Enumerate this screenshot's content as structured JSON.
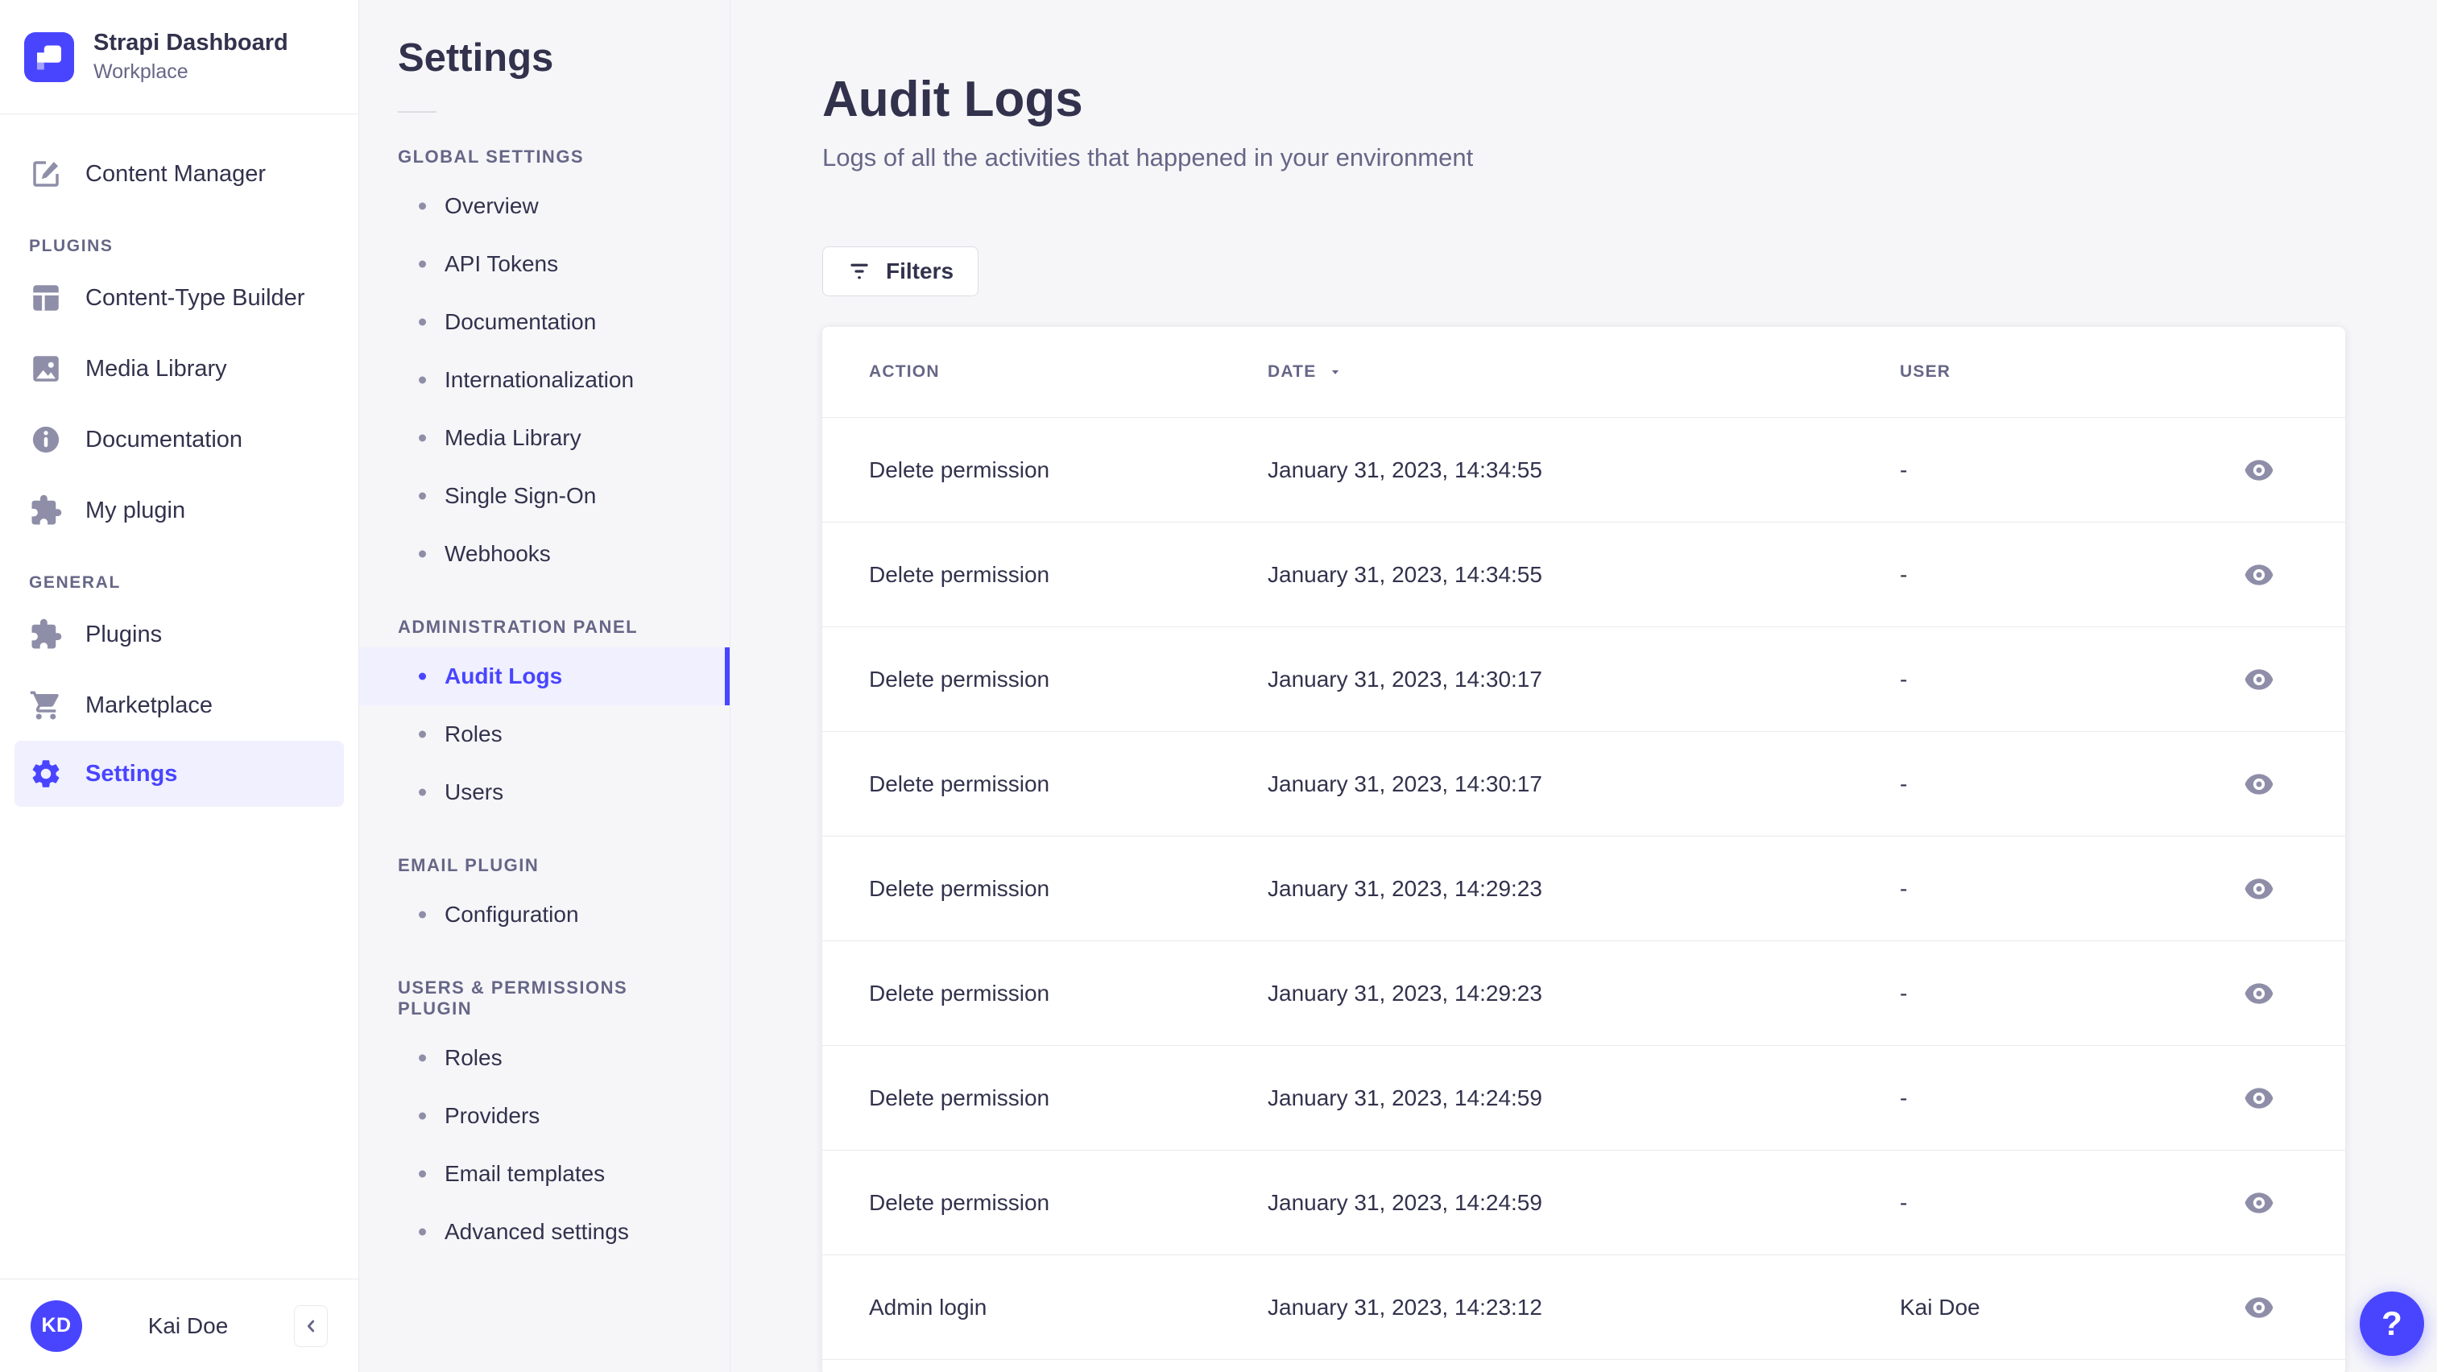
{
  "app": {
    "name": "Strapi Dashboard",
    "workspace": "Workplace",
    "user_initials": "KD",
    "user_name": "Kai Doe"
  },
  "colors": {
    "primary": "#4945ff",
    "primary_light_bg": "#f0f0ff",
    "text_dark": "#32324d",
    "text_muted": "#666687",
    "icon_muted": "#8e8ea9",
    "border": "#eaeaef",
    "page_bg": "#f6f6f9",
    "card_bg": "#ffffff"
  },
  "main_nav": {
    "content_manager": "Content Manager",
    "plugins_label": "PLUGINS",
    "plugins_items": [
      "Content-Type Builder",
      "Media Library",
      "Documentation",
      "My plugin"
    ],
    "general_label": "GENERAL",
    "general_items": [
      "Plugins",
      "Marketplace",
      "Settings"
    ],
    "active_item": "Settings"
  },
  "settings_nav": {
    "title": "Settings",
    "sections": [
      {
        "label": "GLOBAL SETTINGS",
        "items": [
          "Overview",
          "API Tokens",
          "Documentation",
          "Internationalization",
          "Media Library",
          "Single Sign-On",
          "Webhooks"
        ]
      },
      {
        "label": "ADMINISTRATION PANEL",
        "items": [
          "Audit Logs",
          "Roles",
          "Users"
        ]
      },
      {
        "label": "EMAIL PLUGIN",
        "items": [
          "Configuration"
        ]
      },
      {
        "label": "USERS & PERMISSIONS PLUGIN",
        "items": [
          "Roles",
          "Providers",
          "Email templates",
          "Advanced settings"
        ]
      }
    ],
    "active_item": "Audit Logs"
  },
  "page": {
    "title": "Audit Logs",
    "subtitle": "Logs of all the activities that happened in your environment",
    "filters_label": "Filters"
  },
  "table": {
    "columns": [
      "ACTION",
      "DATE",
      "USER"
    ],
    "sorted_by": "DATE",
    "sort_direction": "desc",
    "rows": [
      {
        "action": "Delete permission",
        "date": "January 31, 2023, 14:34:55",
        "user": "-"
      },
      {
        "action": "Delete permission",
        "date": "January 31, 2023, 14:34:55",
        "user": "-"
      },
      {
        "action": "Delete permission",
        "date": "January 31, 2023, 14:30:17",
        "user": "-"
      },
      {
        "action": "Delete permission",
        "date": "January 31, 2023, 14:30:17",
        "user": "-"
      },
      {
        "action": "Delete permission",
        "date": "January 31, 2023, 14:29:23",
        "user": "-"
      },
      {
        "action": "Delete permission",
        "date": "January 31, 2023, 14:29:23",
        "user": "-"
      },
      {
        "action": "Delete permission",
        "date": "January 31, 2023, 14:24:59",
        "user": "-"
      },
      {
        "action": "Delete permission",
        "date": "January 31, 2023, 14:24:59",
        "user": "-"
      },
      {
        "action": "Admin login",
        "date": "January 31, 2023, 14:23:12",
        "user": "Kai Doe"
      }
    ]
  },
  "help": {
    "label": "?"
  }
}
